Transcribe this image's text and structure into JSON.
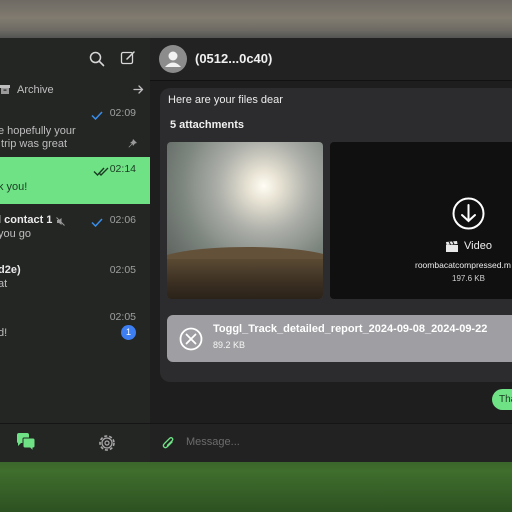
{
  "sidebar": {
    "archive_label": "Archive",
    "chats": [
      {
        "line1": "",
        "line2": "e hopefully your\n trip was great",
        "time": "02:09",
        "status": "read",
        "pinned": true
      },
      {
        "line1": "k you!",
        "line2": "",
        "time": "02:14",
        "status": "read",
        "active": true
      },
      {
        "line1": "l contact 1",
        "line2": " you go",
        "time": "02:06",
        "status": "read",
        "muted": true
      },
      {
        "line1": "d2e)",
        "line2": "at",
        "time": "02:05"
      },
      {
        "line1": "d!",
        "line2": "",
        "time": "02:05",
        "badge": "1"
      }
    ]
  },
  "chat": {
    "title": "(0512...0c40)",
    "message_text": "Here are your files dear",
    "attachments_label": "5 attachments",
    "video_label": "Video",
    "video_filename": "roombacatcompressed.m",
    "video_size": "197.6 KB",
    "file_name": "Toggl_Track_detailed_report_2024-09-08_2024-09-22",
    "file_size": "89.2 KB",
    "sent_text": "Tha",
    "composer_placeholder": "Message..."
  },
  "colors": {
    "accent_green": "#6fe286",
    "badge_blue": "#3d7ef2",
    "check_blue": "#3a8de8"
  }
}
